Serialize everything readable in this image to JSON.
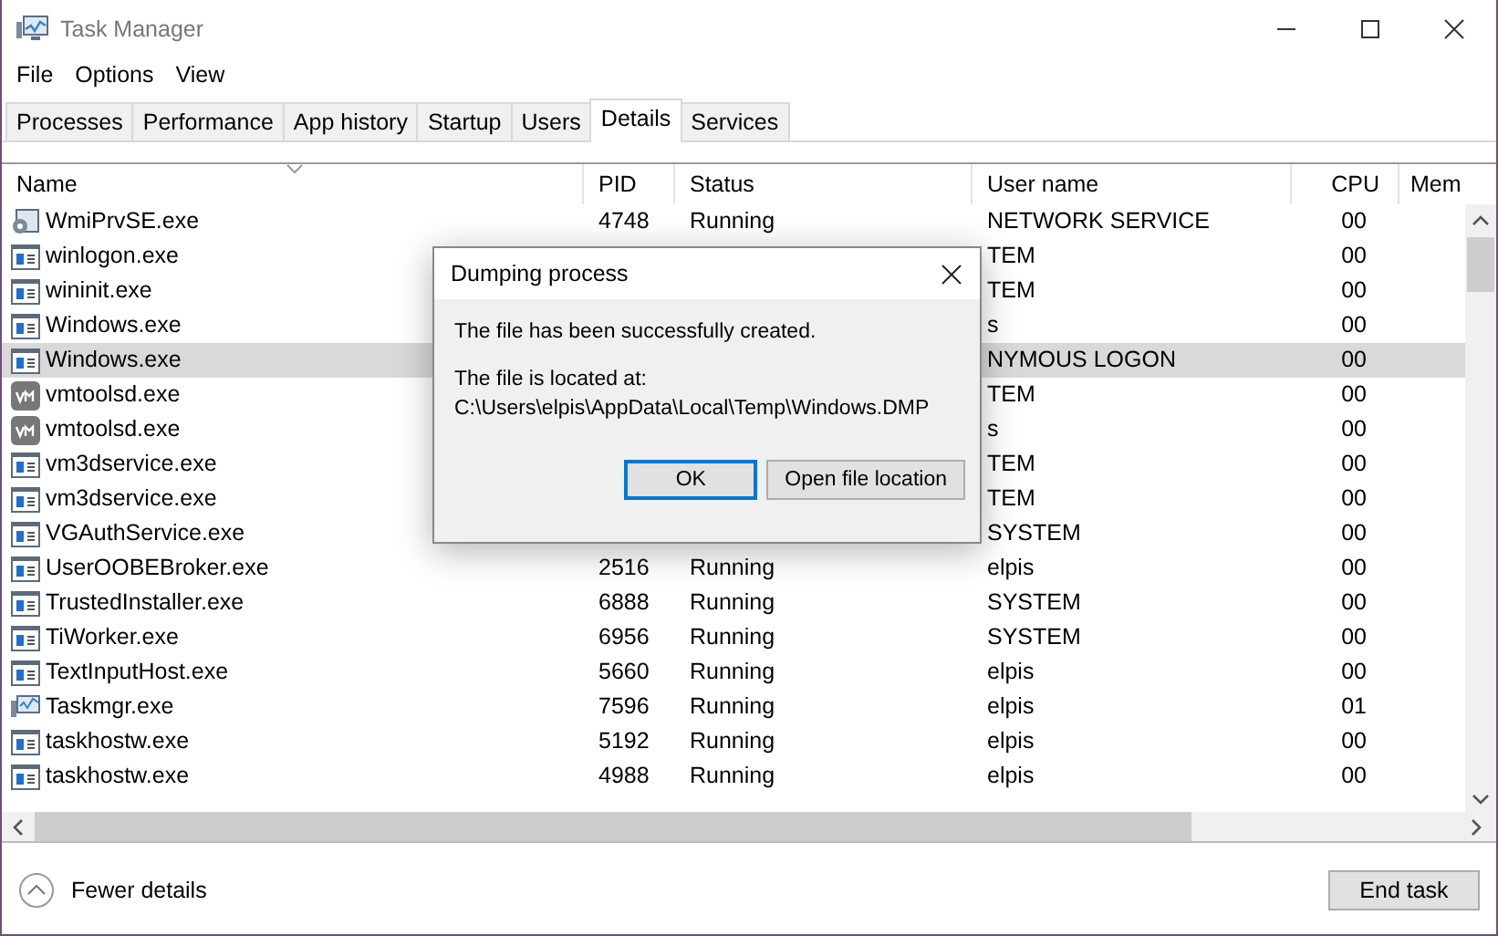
{
  "window": {
    "title": "Task Manager"
  },
  "menu": [
    "File",
    "Options",
    "View"
  ],
  "tabs": [
    {
      "label": "Processes",
      "selected": false
    },
    {
      "label": "Performance",
      "selected": false
    },
    {
      "label": "App history",
      "selected": false
    },
    {
      "label": "Startup",
      "selected": false
    },
    {
      "label": "Users",
      "selected": false
    },
    {
      "label": "Details",
      "selected": true
    },
    {
      "label": "Services",
      "selected": false
    }
  ],
  "table": {
    "columns": [
      "Name",
      "PID",
      "Status",
      "User name",
      "CPU",
      "Mem"
    ],
    "rows": [
      {
        "kind": "wmi",
        "name": "WmiPrvSE.exe",
        "pid": "4748",
        "status": "Running",
        "user": "NETWORK SERVICE",
        "cpu": "00",
        "selected": false
      },
      {
        "kind": "app",
        "name": "winlogon.exe",
        "user": "TEM",
        "cpu": "00",
        "selected": false
      },
      {
        "kind": "app",
        "name": "wininit.exe",
        "user": "TEM",
        "cpu": "00",
        "selected": false
      },
      {
        "kind": "app",
        "name": "Windows.exe",
        "user": "s",
        "cpu": "00",
        "selected": false
      },
      {
        "kind": "app",
        "name": "Windows.exe",
        "user": "NYMOUS LOGON",
        "cpu": "00",
        "selected": true
      },
      {
        "kind": "vm",
        "name": "vmtoolsd.exe",
        "user": "TEM",
        "cpu": "00",
        "selected": false
      },
      {
        "kind": "vm",
        "name": "vmtoolsd.exe",
        "user": "s",
        "cpu": "00",
        "selected": false
      },
      {
        "kind": "app",
        "name": "vm3dservice.exe",
        "user": "TEM",
        "cpu": "00",
        "selected": false
      },
      {
        "kind": "app",
        "name": "vm3dservice.exe",
        "user": "TEM",
        "cpu": "00",
        "selected": false
      },
      {
        "kind": "app",
        "name": "VGAuthService.exe",
        "user": "SYSTEM",
        "cpu": "00",
        "selected": false
      },
      {
        "kind": "app",
        "name": "UserOOBEBroker.exe",
        "pid": "2516",
        "status": "Running",
        "user": "elpis",
        "cpu": "00",
        "selected": false
      },
      {
        "kind": "app",
        "name": "TrustedInstaller.exe",
        "pid": "6888",
        "status": "Running",
        "user": "SYSTEM",
        "cpu": "00",
        "selected": false
      },
      {
        "kind": "app",
        "name": "TiWorker.exe",
        "pid": "6956",
        "status": "Running",
        "user": "SYSTEM",
        "cpu": "00",
        "selected": false
      },
      {
        "kind": "app",
        "name": "TextInputHost.exe",
        "pid": "5660",
        "status": "Running",
        "user": "elpis",
        "cpu": "00",
        "selected": false
      },
      {
        "kind": "taskmgr",
        "name": "Taskmgr.exe",
        "pid": "7596",
        "status": "Running",
        "user": "elpis",
        "cpu": "01",
        "selected": false
      },
      {
        "kind": "app",
        "name": "taskhostw.exe",
        "pid": "5192",
        "status": "Running",
        "user": "elpis",
        "cpu": "00",
        "selected": false
      },
      {
        "kind": "app",
        "name": "taskhostw.exe",
        "pid": "4988",
        "status": "Running",
        "user": "elpis",
        "cpu": "00",
        "selected": false
      }
    ]
  },
  "dialog": {
    "title": "Dumping process",
    "message": "The file has been successfully created.",
    "location_label": "The file is located at:",
    "path": "C:\\Users\\elpis\\AppData\\Local\\Temp\\Windows.DMP",
    "buttons": [
      {
        "label": "OK",
        "default": true
      },
      {
        "label": "Open file location",
        "default": false
      }
    ]
  },
  "footer": {
    "toggle": "Fewer details",
    "button": "End task"
  }
}
